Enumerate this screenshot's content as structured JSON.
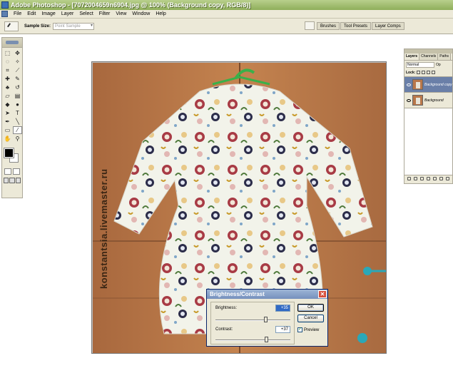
{
  "window": {
    "title": "Adobe Photoshop - [7072004659n6904.jpg @ 100% (Background copy, RGB/8)]"
  },
  "menu": [
    "File",
    "Edit",
    "Image",
    "Layer",
    "Select",
    "Filter",
    "View",
    "Window",
    "Help"
  ],
  "options_bar": {
    "sample_size_label": "Sample Size:",
    "sample_size_value": "Point Sample"
  },
  "palette_wells": [
    "Brushes",
    "Tool Presets",
    "Layer Comps"
  ],
  "canvas": {
    "watermark": "konstantsia.livemaster.ru"
  },
  "layers_panel": {
    "tabs": [
      "Layers",
      "Channels",
      "Paths"
    ],
    "blend_mode": "Normal",
    "opacity_label": "Op",
    "lock_label": "Lock:",
    "layers": [
      {
        "name": "Background copy",
        "selected": true
      },
      {
        "name": "Background",
        "selected": false
      }
    ]
  },
  "dialog": {
    "title": "Brightness/Contrast",
    "brightness_label": "Brightness:",
    "brightness_value": "+35",
    "brightness_level": 0.67,
    "contrast_label": "Contrast:",
    "contrast_value": "+37",
    "contrast_level": 0.68,
    "ok_label": "OK",
    "cancel_label": "Cancel",
    "preview_label": "Preview",
    "preview_checked": true
  },
  "colors": {
    "title_bar": "#8fae5a",
    "dialog_title": "#7590bd",
    "wood": "#b9774a"
  }
}
